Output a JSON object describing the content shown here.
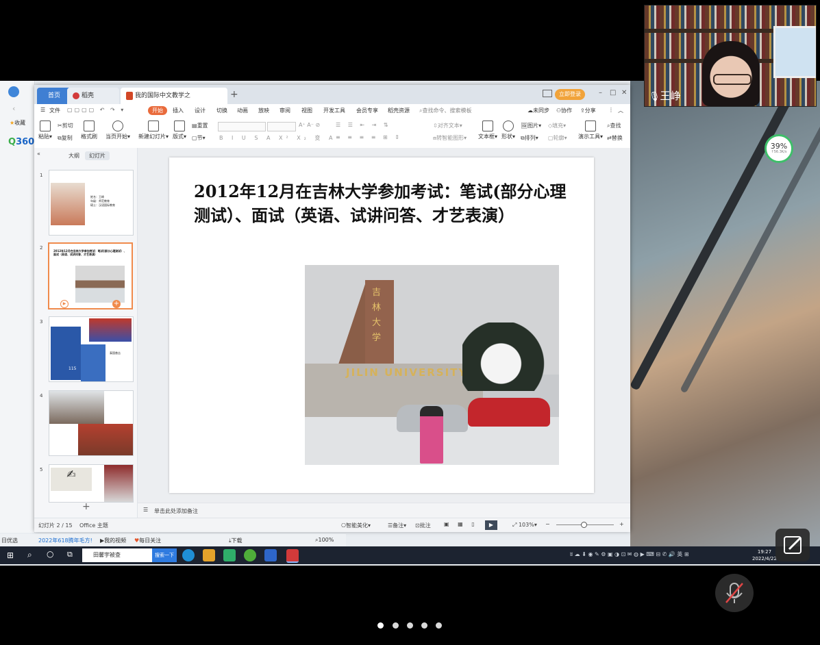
{
  "video_tile": {
    "participant_name": "王峥",
    "mic_icon": "microphone-icon"
  },
  "shared_screen": {
    "performance_gauge": {
      "percent": "39%",
      "speed": "↑56.3K/s"
    },
    "browser_left": {
      "collect_label": "收藏",
      "brand": "360"
    },
    "wps": {
      "tabs": [
        {
          "label": "首页"
        },
        {
          "label": "稻壳"
        },
        {
          "label": "我的国际中文教学之路.pptx"
        }
      ],
      "login_button": "立即登录",
      "menu_items": [
        "文件",
        "开始",
        "插入",
        "设计",
        "切换",
        "动画",
        "放映",
        "审阅",
        "视图",
        "开发工具",
        "会员专享",
        "稻壳资源"
      ],
      "search_placeholder": "查找命令、搜索模板",
      "menu_right": {
        "sync": "未同步",
        "collab": "协作",
        "share": "分享"
      },
      "ribbon": {
        "paste": "粘贴",
        "cut": "剪切",
        "copy": "复制",
        "format_painter": "格式刷",
        "from_current": "当页开始",
        "new_slide": "新建幻灯片",
        "layout": "版式",
        "reset": "重置",
        "section": "节",
        "text_box": "文本框",
        "shape": "形状",
        "arrange": "排列",
        "picture": "图片",
        "fill": "填充",
        "outline": "轮廓",
        "present_tools": "演示工具",
        "find": "查找",
        "replace": "替换",
        "align_text": "对齐文本",
        "smartart": "转智能图形"
      },
      "panel": {
        "outline_tab": "大纲",
        "slides_tab": "幻灯片"
      },
      "thumb1": {
        "lines": [
          "姓名：王峥",
          "年级：师范教育",
          "硕士：汉语国际教育"
        ]
      },
      "thumb2": {
        "text": "2012年12月在吉林大学参加考试：笔试(部分心理测试）、面试（英语、试讲问答、才艺表演）"
      },
      "thumb3": {
        "caption": "泰国普吉",
        "number": "115"
      },
      "slide_numbers": [
        "1",
        "2",
        "3",
        "4",
        "5"
      ],
      "slide": {
        "title": "2012年12月在吉林大学参加考试：笔试(部分心理测试）、面试（英语、试讲问答、才艺表演）",
        "photo_sign_en": "JILIN UNIVERSITY",
        "photo_sign_cn": "吉林大学"
      },
      "notes_placeholder": "单击此处添加备注",
      "status": {
        "slide_counter": "幻灯片 2 / 15",
        "theme": "Office 主题",
        "smart_beautify": "智能美化",
        "notes": "备注",
        "comments": "批注",
        "zoom": "103%"
      }
    },
    "bookmark_bar": [
      "日优选",
      "2022年618腾年毛方!",
      "我的视频",
      "每日关注",
      "下载",
      "100%"
    ],
    "taskbar": {
      "search_text": "田馨宇被查",
      "search_button": "搜索一下",
      "clock_time": "19:27",
      "clock_date": "2022/4/22",
      "ime": "英"
    }
  },
  "pager": {
    "count": 5,
    "active_index": 0
  }
}
